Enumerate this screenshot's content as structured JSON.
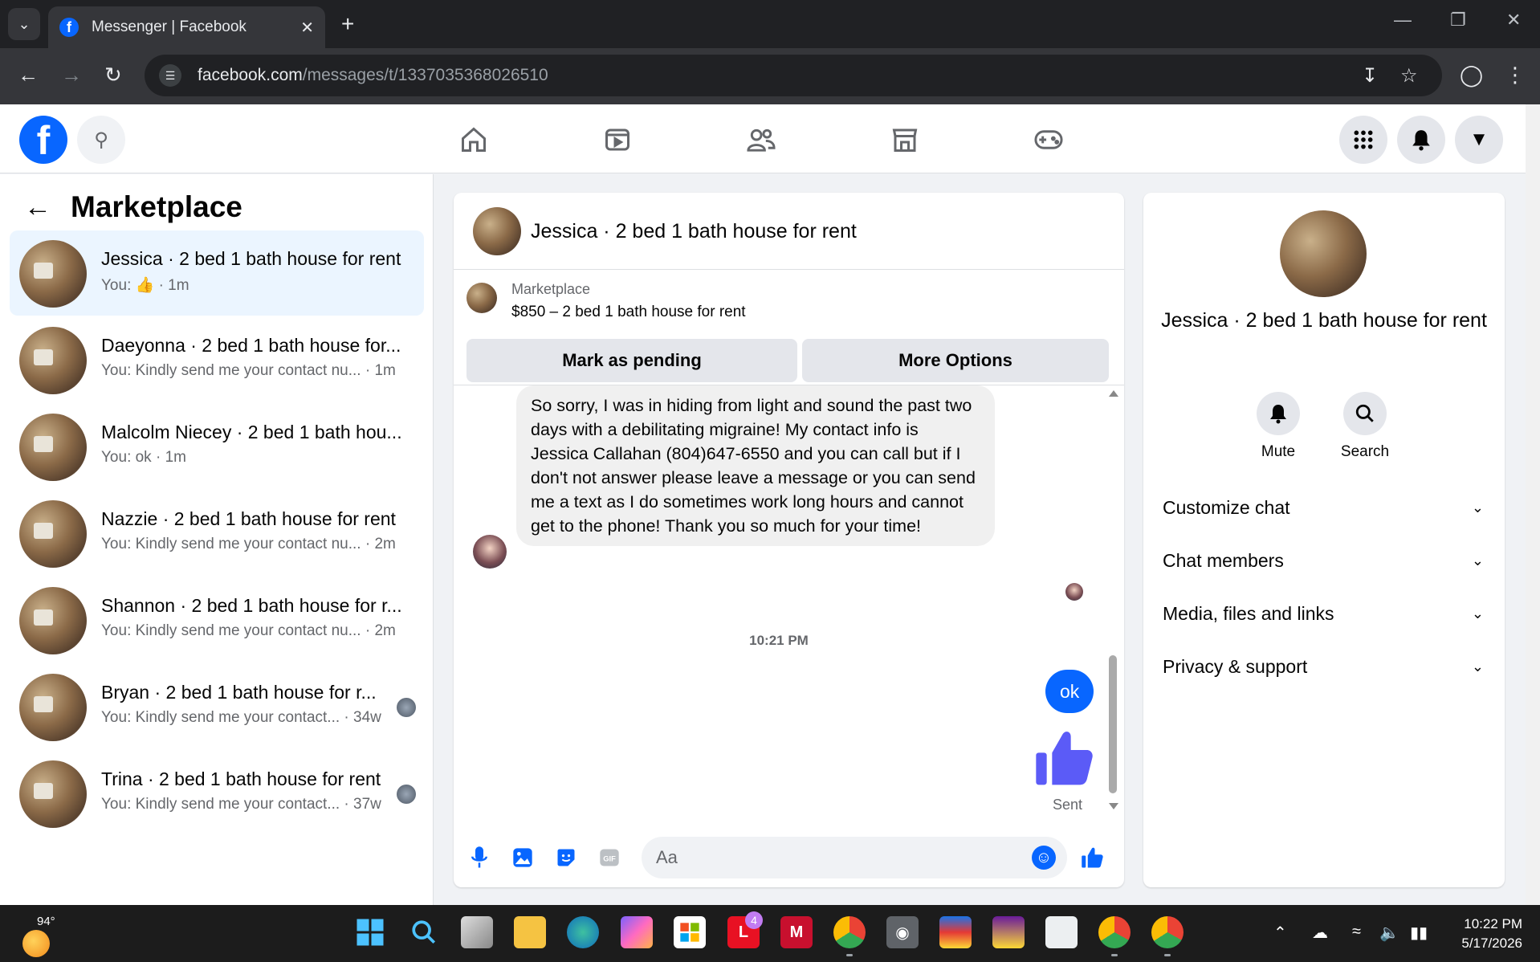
{
  "browser": {
    "tab_title": "Messenger | Facebook",
    "url_host": "facebook.com",
    "url_path": "/messages/t/1337035368026510"
  },
  "sidebar": {
    "title": "Marketplace",
    "conversations": [
      {
        "name": "Jessica · 2 bed 1 bath house for rent",
        "preview": "You: ",
        "time": "· 1m",
        "active": true
      },
      {
        "name": "Daeyonna · 2 bed 1 bath house for...",
        "preview": "You: Kindly send me your contact nu...",
        "time": "· 1m"
      },
      {
        "name": "Malcolm Niecey · 2 bed 1 bath hou...",
        "preview": "You: ok",
        "time": "· 1m"
      },
      {
        "name": "Nazzie · 2 bed 1 bath house for rent",
        "preview": "You: Kindly send me your contact nu...",
        "time": "· 2m"
      },
      {
        "name": "Shannon · 2 bed 1 bath house for r...",
        "preview": "You: Kindly send me your contact nu...",
        "time": "· 2m"
      },
      {
        "name": "Bryan · 2 bed 1 bath house for r...",
        "preview": "You: Kindly send me your contact...",
        "time": "· 34w"
      },
      {
        "name": "Trina · 2 bed 1 bath house for rent",
        "preview": "You: Kindly send me your contact...",
        "time": "· 37w"
      }
    ]
  },
  "chat": {
    "title": "Jessica · 2 bed 1 bath house for rent",
    "listing": {
      "category": "Marketplace",
      "title": "$850 – 2 bed 1 bath house for rent",
      "btn_pending": "Mark as pending",
      "btn_more": "More Options"
    },
    "incoming_message": "So sorry, I was in hiding from light and sound the past two days with a debilitating migraine! My contact info is Jessica Callahan  (804)647-6550 and you can call but if I don't not answer please leave a message or you can send me a text as I do sometimes work long hours and cannot get to the phone! Thank you so much for your time!",
    "timestamp": "10:21 PM",
    "outgoing_message": "ok",
    "status": "Sent",
    "composer_placeholder": "Aa"
  },
  "info_panel": {
    "name": "Jessica · 2 bed 1 bath house for rent",
    "mute_label": "Mute",
    "search_label": "Search",
    "sections": [
      "Customize chat",
      "Chat members",
      "Media, files and links",
      "Privacy & support"
    ]
  },
  "taskbar": {
    "temperature": "94°",
    "time": "10:22 PM",
    "date": "5/17/2026",
    "badge_l": "4"
  },
  "colors": {
    "accent": "#0866ff",
    "info_purple": "#a200e8",
    "like_purple": "#5b5bf7"
  }
}
